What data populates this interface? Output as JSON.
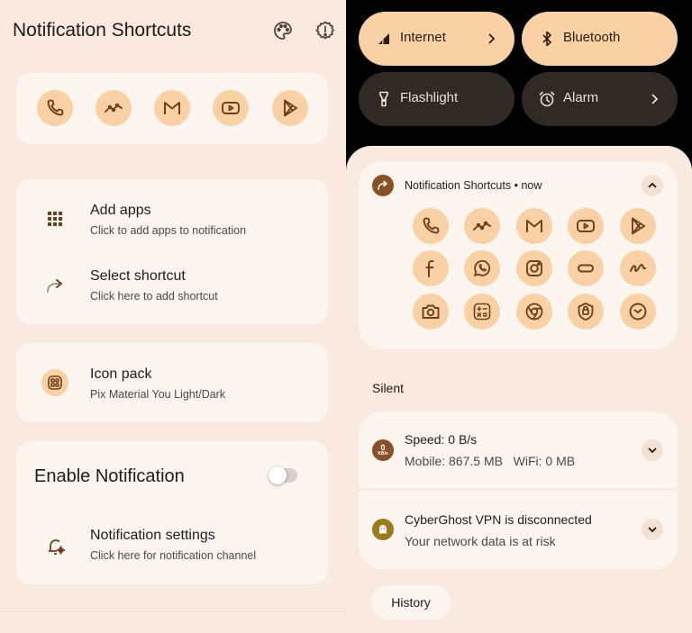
{
  "left": {
    "app_title": "Notification Shortcuts",
    "header_icons": [
      "palette-icon",
      "settings-icon"
    ],
    "shortcut_icons": [
      "phone-icon",
      "stock-chart-icon",
      "gmail-icon",
      "youtube-icon",
      "play-store-icon"
    ],
    "add_apps": {
      "title": "Add apps",
      "subtitle": "Click to add apps to notification"
    },
    "select_shortcut": {
      "title": "Select shortcut",
      "subtitle": "Click here to add shortcut"
    },
    "icon_pack": {
      "title": "Icon pack",
      "subtitle": "Pix Material You Light/Dark"
    },
    "enable_notification": {
      "title": "Enable Notification",
      "enabled": false
    },
    "notification_settings": {
      "title": "Notification settings",
      "subtitle": "Click here for notification channel"
    }
  },
  "right": {
    "tiles": [
      {
        "label": "Internet",
        "state": "on",
        "icon": "signal-icon",
        "has_chevron": true
      },
      {
        "label": "Bluetooth",
        "state": "on",
        "icon": "bluetooth-icon",
        "has_chevron": false
      },
      {
        "label": "Flashlight",
        "state": "off",
        "icon": "flashlight-icon",
        "has_chevron": false
      },
      {
        "label": "Alarm",
        "state": "off",
        "icon": "alarm-icon",
        "has_chevron": true
      }
    ],
    "shortcut_notification": {
      "app_name": "Notification Shortcuts",
      "separator": "•",
      "time": "now",
      "icons": [
        "phone-icon",
        "stock-chart-icon",
        "gmail-icon",
        "youtube-icon",
        "play-store-icon",
        "facebook-icon",
        "whatsapp-icon",
        "instagram-icon",
        "pill-icon",
        "squiggle-icon",
        "camera-icon",
        "calculator-icon",
        "chrome-icon",
        "shield-icon",
        "clock-icon"
      ]
    },
    "section_label": "Silent",
    "speed_notification": {
      "badge_value": "0",
      "badge_unit": "KB/s",
      "title": "Speed: 0 B/s",
      "mobile": "Mobile: 867.5 MB",
      "wifi": "WiFi: 0 MB"
    },
    "vpn_notification": {
      "title": "CyberGhost VPN is disconnected",
      "subtitle": "Your network data is at risk"
    },
    "history_label": "History"
  },
  "colors": {
    "background": "#f9e9de",
    "card": "#fdf6f0",
    "accent_container": "#f9d1a4",
    "icon_brown": "#6f3f1c",
    "dark_tile": "#302924"
  }
}
